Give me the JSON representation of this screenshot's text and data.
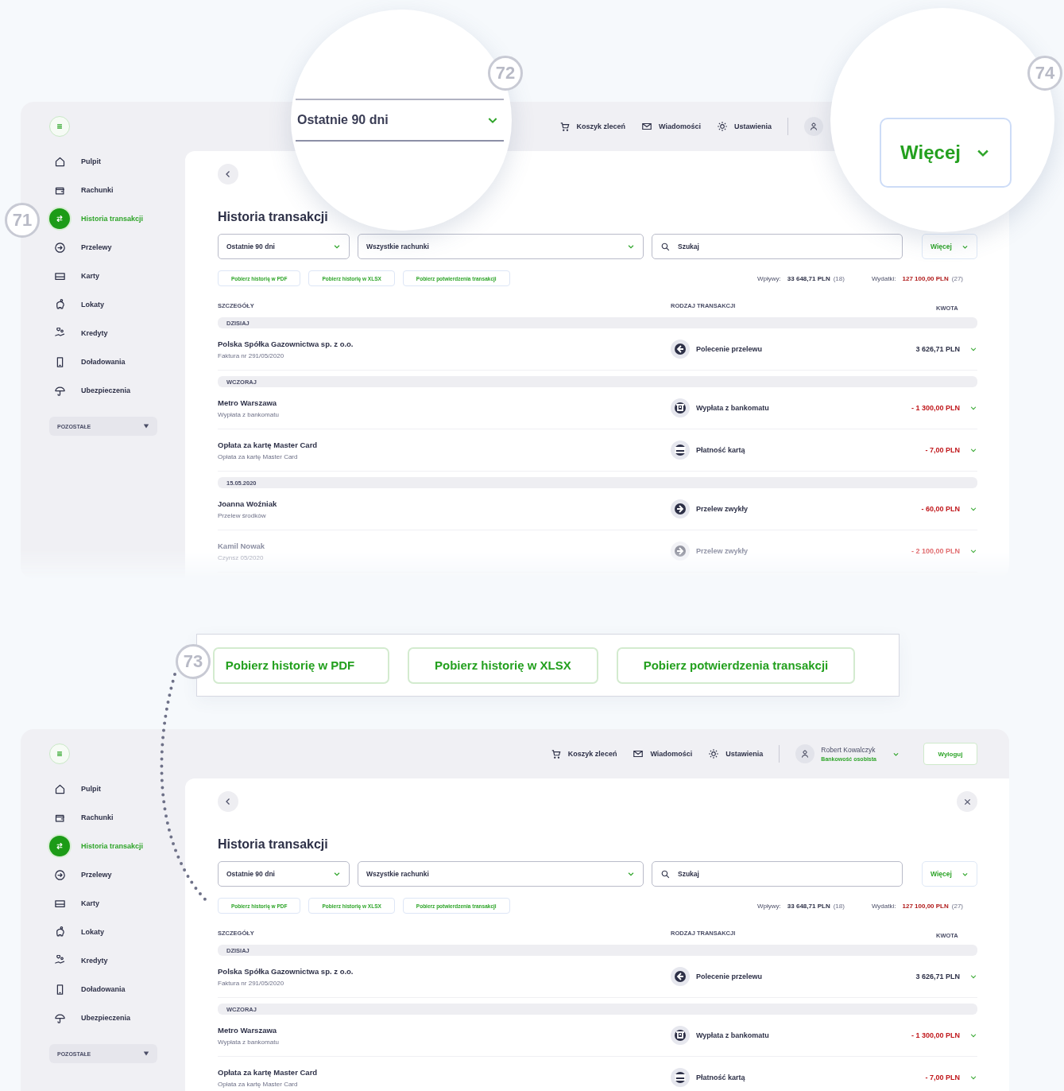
{
  "screens": [
    {
      "sidebar": {
        "items": [
          {
            "label": "Pulpit",
            "selected": false
          },
          {
            "label": "Rachunki",
            "selected": false
          },
          {
            "label": "Historia transakcji",
            "selected": true
          },
          {
            "label": "Przelewy",
            "selected": false
          },
          {
            "label": "Karty",
            "selected": false
          },
          {
            "label": "Lokaty",
            "selected": false
          },
          {
            "label": "Kredyty",
            "selected": false
          },
          {
            "label": "Doładowania",
            "selected": false
          },
          {
            "label": "Ubezpieczenia",
            "selected": false
          }
        ],
        "more": "POZOSTAŁE"
      },
      "topbar": {
        "links": [
          "Koszyk zleceń",
          "Wiadomości",
          "Ustawienia"
        ]
      },
      "close_button": false,
      "title": "Historia transakcji",
      "filters": {
        "period": "Ostatnie 90 dni",
        "accounts": "Wszystkie rachunki",
        "search_placeholder": "Szukaj",
        "more": "Więcej"
      },
      "downloads": [
        "Pobierz historię w PDF",
        "Pobierz historię w XLSX",
        "Pobierz potwierdzenia transakcji"
      ],
      "summary": {
        "income_label": "Wpływy:",
        "income": "33 648,71 PLN",
        "income_count": "(18)",
        "expense_label": "Wydatki:",
        "expense": "127 100,00 PLN",
        "expense_count": "(27)"
      },
      "columns": [
        "SZCZEGÓŁY",
        "RODZAJ TRANSAKCJI",
        "KWOTA"
      ],
      "groups": [
        {
          "label": "DZISIAJ",
          "rows": [
            {
              "name": "Polska Spółka Gazownictwa sp. z o.o.",
              "description": "Faktura nr 291/05/2020",
              "kind": "order",
              "type": "Polecenie przelewu",
              "amount": "3 626,71 PLN",
              "negative": false,
              "faded": false
            }
          ]
        },
        {
          "label": "WCZORAJ",
          "rows": [
            {
              "name": "Metro Warszawa",
              "description": "Wypłata z bankomatu",
              "kind": "atm",
              "type": "Wypłata z bankomatu",
              "amount": "- 1 300,00 PLN",
              "negative": true,
              "faded": false
            },
            {
              "name": "Opłata za kartę Master Card",
              "description": "Opłata za kartę Master Card",
              "kind": "card",
              "type": "Płatność kartą",
              "amount": "- 7,00 PLN",
              "negative": true,
              "faded": false
            }
          ]
        },
        {
          "label": "15.05.2020",
          "rows": [
            {
              "name": "Joanna Woźniak",
              "description": "Przelew środków",
              "kind": "transfer",
              "type": "Przelew zwykły",
              "amount": "- 60,00 PLN",
              "negative": true,
              "faded": false
            },
            {
              "name": "Kamil Nowak",
              "description": "Czynsz 05/2020",
              "kind": "transfer",
              "type": "Przelew zwykły",
              "amount": "- 2 100,00 PLN",
              "negative": true,
              "faded": true
            }
          ]
        }
      ]
    },
    {
      "sidebar": {
        "items": [
          {
            "label": "Pulpit",
            "selected": false
          },
          {
            "label": "Rachunki",
            "selected": false
          },
          {
            "label": "Historia transakcji",
            "selected": true
          },
          {
            "label": "Przelewy",
            "selected": false
          },
          {
            "label": "Karty",
            "selected": false
          },
          {
            "label": "Lokaty",
            "selected": false
          },
          {
            "label": "Kredyty",
            "selected": false
          },
          {
            "label": "Doładowania",
            "selected": false
          },
          {
            "label": "Ubezpieczenia",
            "selected": false
          }
        ],
        "more": "POZOSTAŁE"
      },
      "topbar": {
        "links": [
          "Koszyk zleceń",
          "Wiadomości",
          "Ustawienia"
        ],
        "user_name": "Robert Kowalczyk",
        "user_role": "Bankowość osobista",
        "logout": "Wyloguj"
      },
      "close_button": true,
      "title": "Historia transakcji",
      "filters": {
        "period": "Ostatnie 90 dni",
        "accounts": "Wszystkie rachunki",
        "search_placeholder": "Szukaj",
        "more": "Więcej"
      },
      "downloads": [
        "Pobierz historię w PDF",
        "Pobierz historię w XLSX",
        "Pobierz potwierdzenia transakcji"
      ],
      "summary": {
        "income_label": "Wpływy:",
        "income": "33 648,71 PLN",
        "income_count": "(18)",
        "expense_label": "Wydatki:",
        "expense": "127 100,00 PLN",
        "expense_count": "(27)"
      },
      "columns": [
        "SZCZEGÓŁY",
        "RODZAJ TRANSAKCJI",
        "KWOTA"
      ],
      "groups": [
        {
          "label": "DZISIAJ",
          "rows": [
            {
              "name": "Polska Spółka Gazownictwa sp. z o.o.",
              "description": "Faktura nr 291/05/2020",
              "kind": "order",
              "type": "Polecenie przelewu",
              "amount": "3 626,71 PLN",
              "negative": false,
              "faded": false
            }
          ]
        },
        {
          "label": "WCZORAJ",
          "rows": [
            {
              "name": "Metro Warszawa",
              "description": "Wypłata z bankomatu",
              "kind": "atm",
              "type": "Wypłata z bankomatu",
              "amount": "- 1 300,00 PLN",
              "negative": true,
              "faded": false
            },
            {
              "name": "Opłata za kartę Master Card",
              "description": "Opłata za kartę Master Card",
              "kind": "card",
              "type": "Płatność kartą",
              "amount": "- 7,00 PLN",
              "negative": true,
              "faded": false
            }
          ]
        }
      ]
    }
  ],
  "callouts": {
    "sidebar_marker": "71",
    "dropdown_zoom": {
      "number": "72",
      "dropdown": "Ostatnie 90 dni"
    },
    "downloads_zoom": {
      "number": "73",
      "buttons": [
        "Pobierz historię w PDF",
        "Pobierz historię w XLSX",
        "Pobierz potwierdzenia transakcji"
      ]
    },
    "more_zoom": {
      "number": "74",
      "button": "Więcej"
    }
  }
}
